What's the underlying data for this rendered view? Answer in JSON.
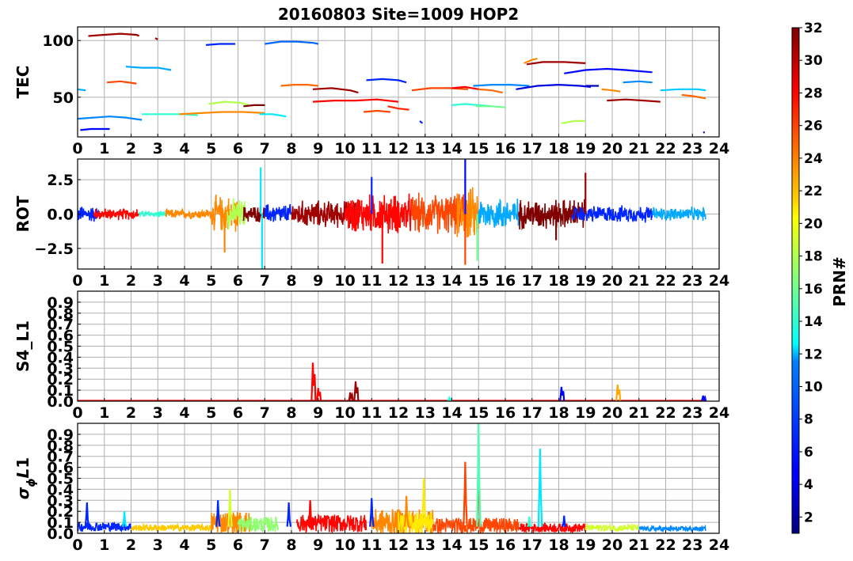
{
  "chart_data": [
    {
      "type": "line",
      "panel": "TEC",
      "title": "20160803 Site=1009 HOP2",
      "xlabel": "",
      "ylabel": "TEC",
      "xlim": [
        0,
        24
      ],
      "ylim": [
        15,
        112
      ],
      "x_ticks": [
        0,
        1,
        2,
        3,
        4,
        5,
        6,
        7,
        8,
        9,
        10,
        11,
        12,
        13,
        14,
        15,
        16,
        17,
        18,
        19,
        20,
        21,
        22,
        23,
        24
      ],
      "x_tick_labels": [
        "0",
        "1",
        "2",
        "3",
        "4",
        "5",
        "6",
        "7",
        "8",
        "9",
        "10",
        "11",
        "12",
        "13",
        "14",
        "15",
        "16",
        "17",
        "18",
        "19",
        "20",
        "21",
        "22",
        "23",
        "24"
      ],
      "y_ticks": [
        50,
        100
      ],
      "y_tick_labels": [
        "50",
        "100"
      ],
      "grid": true,
      "series": [
        {
          "prn": 31,
          "x": [
            0.4,
            1.0,
            1.6,
            2.2,
            2.3
          ],
          "y": [
            104,
            105,
            106,
            105,
            104
          ]
        },
        {
          "prn": 31,
          "x": [
            2.9,
            3.0
          ],
          "y": [
            102,
            101
          ]
        },
        {
          "prn": 6,
          "x": [
            4.8,
            5.3,
            5.9
          ],
          "y": [
            96,
            97,
            97
          ]
        },
        {
          "prn": 8,
          "x": [
            7.0,
            7.6,
            8.2,
            8.8,
            9.0
          ],
          "y": [
            97,
            99,
            99,
            98,
            97
          ]
        },
        {
          "prn": 10,
          "x": [
            1.8,
            2.4,
            3.0,
            3.5
          ],
          "y": [
            77,
            76,
            76,
            74
          ]
        },
        {
          "prn": 26,
          "x": [
            1.1,
            1.6,
            2.2
          ],
          "y": [
            63,
            64,
            62
          ]
        },
        {
          "prn": 10,
          "x": [
            0.0,
            0.3
          ],
          "y": [
            57,
            56
          ]
        },
        {
          "prn": 25,
          "x": [
            7.6,
            8.1,
            8.6,
            9.0
          ],
          "y": [
            60,
            61,
            61,
            60
          ]
        },
        {
          "prn": 31,
          "x": [
            8.8,
            9.5,
            10.2,
            10.5
          ],
          "y": [
            57,
            58,
            56,
            54
          ]
        },
        {
          "prn": 6,
          "x": [
            10.8,
            11.4,
            12.0,
            12.3
          ],
          "y": [
            65,
            66,
            65,
            63
          ]
        },
        {
          "prn": 26,
          "x": [
            12.5,
            13.2,
            13.9,
            14.6
          ],
          "y": [
            56,
            58,
            58,
            57
          ]
        },
        {
          "prn": 28,
          "x": [
            14.0,
            14.5,
            15.0
          ],
          "y": [
            58,
            59,
            57
          ]
        },
        {
          "prn": 9,
          "x": [
            14.8,
            15.5,
            16.2,
            16.9
          ],
          "y": [
            60,
            61,
            61,
            60
          ]
        },
        {
          "prn": 25,
          "x": [
            15.0,
            15.5,
            15.9
          ],
          "y": [
            57,
            56,
            54
          ]
        },
        {
          "prn": 4,
          "x": [
            16.4,
            17.2,
            18.0,
            18.8,
            19.2
          ],
          "y": [
            57,
            60,
            61,
            60,
            59
          ]
        },
        {
          "prn": 24,
          "x": [
            16.7,
            17.0,
            17.2
          ],
          "y": [
            80,
            83,
            84
          ]
        },
        {
          "prn": 31,
          "x": [
            16.8,
            17.4,
            18.2,
            19.0
          ],
          "y": [
            79,
            81,
            81,
            80
          ]
        },
        {
          "prn": 5,
          "x": [
            18.2,
            19.0,
            19.8,
            20.5,
            21.5
          ],
          "y": [
            71,
            74,
            75,
            74,
            72
          ]
        },
        {
          "prn": 9,
          "x": [
            20.4,
            21.0,
            21.5
          ],
          "y": [
            63,
            64,
            63
          ]
        },
        {
          "prn": 3,
          "x": [
            19.0,
            19.5
          ],
          "y": [
            60,
            60
          ]
        },
        {
          "prn": 24,
          "x": [
            19.6,
            20.0,
            20.3
          ],
          "y": [
            57,
            56,
            55
          ]
        },
        {
          "prn": 11,
          "x": [
            21.8,
            22.5,
            23.2,
            23.5
          ],
          "y": [
            56,
            57,
            57,
            56
          ]
        },
        {
          "prn": 25,
          "x": [
            22.6,
            23.0,
            23.5
          ],
          "y": [
            52,
            51,
            49
          ]
        },
        {
          "prn": 31,
          "x": [
            19.8,
            20.5,
            21.2,
            21.8
          ],
          "y": [
            47,
            48,
            47,
            46
          ]
        },
        {
          "prn": 28,
          "x": [
            8.8,
            9.6,
            10.4,
            11.2,
            12.0
          ],
          "y": [
            46,
            47,
            47,
            48,
            46
          ]
        },
        {
          "prn": 26,
          "x": [
            10.7,
            11.2,
            11.7
          ],
          "y": [
            37,
            38,
            37
          ]
        },
        {
          "prn": 27,
          "x": [
            11.6,
            12.0,
            12.4
          ],
          "y": [
            42,
            40,
            39
          ]
        },
        {
          "prn": 14,
          "x": [
            14.0,
            14.5,
            15.0,
            15.5
          ],
          "y": [
            43,
            44,
            43,
            42
          ]
        },
        {
          "prn": 16,
          "x": [
            14.9,
            15.5,
            16.0
          ],
          "y": [
            42,
            42,
            41
          ]
        },
        {
          "prn": 18,
          "x": [
            18.1,
            18.6,
            19.0
          ],
          "y": [
            27,
            29,
            29
          ]
        },
        {
          "prn": 6,
          "x": [
            12.8,
            12.9
          ],
          "y": [
            29,
            27
          ]
        },
        {
          "prn": 3,
          "x": [
            23.4
          ],
          "y": [
            19
          ]
        },
        {
          "prn": 9,
          "x": [
            0.0,
            0.6,
            1.2,
            1.8,
            2.4
          ],
          "y": [
            31,
            32,
            33,
            32,
            30
          ]
        },
        {
          "prn": 5,
          "x": [
            0.1,
            0.5,
            1.2
          ],
          "y": [
            21,
            22,
            22
          ]
        },
        {
          "prn": 14,
          "x": [
            2.4,
            3.2,
            4.0,
            4.5
          ],
          "y": [
            35,
            35,
            35,
            34
          ]
        },
        {
          "prn": 24,
          "x": [
            3.8,
            4.6,
            5.4,
            6.2,
            7.0
          ],
          "y": [
            35,
            36,
            37,
            37,
            36
          ]
        },
        {
          "prn": 18,
          "x": [
            4.9,
            5.5,
            6.1,
            6.4
          ],
          "y": [
            44,
            46,
            45,
            43
          ]
        },
        {
          "prn": 32,
          "x": [
            6.2,
            6.6,
            7.0
          ],
          "y": [
            42,
            43,
            43
          ]
        },
        {
          "prn": 12,
          "x": [
            6.8,
            7.3,
            7.8
          ],
          "y": [
            35,
            35,
            33
          ]
        }
      ]
    },
    {
      "type": "line",
      "panel": "ROT",
      "xlabel": "",
      "ylabel": "ROT",
      "xlim": [
        0,
        24
      ],
      "ylim": [
        -4,
        4
      ],
      "x_ticks": [
        0,
        1,
        2,
        3,
        4,
        5,
        6,
        7,
        8,
        9,
        10,
        11,
        12,
        13,
        14,
        15,
        16,
        17,
        18,
        19,
        20,
        21,
        22,
        23,
        24
      ],
      "x_tick_labels": [
        "0",
        "1",
        "2",
        "3",
        "4",
        "5",
        "6",
        "7",
        "8",
        "9",
        "10",
        "11",
        "12",
        "13",
        "14",
        "15",
        "16",
        "17",
        "18",
        "19",
        "20",
        "21",
        "22",
        "23",
        "24"
      ],
      "y_ticks": [
        -2.5,
        0.0,
        2.5
      ],
      "y_tick_labels": [
        "−2.5",
        "0.0",
        "2.5"
      ],
      "grid": true,
      "segments": [
        {
          "prn": 6,
          "start": 0.0,
          "end": 0.8,
          "amp": 0.5
        },
        {
          "prn": 28,
          "start": 0.6,
          "end": 2.3,
          "amp": 0.35
        },
        {
          "prn": 14,
          "start": 2.3,
          "end": 3.3,
          "amp": 0.2
        },
        {
          "prn": 24,
          "start": 3.3,
          "end": 5.0,
          "amp": 0.3
        },
        {
          "prn": 24,
          "start": 5.0,
          "end": 6.0,
          "amp": 1.1
        },
        {
          "prn": 18,
          "start": 5.6,
          "end": 6.3,
          "amp": 0.9
        },
        {
          "prn": 32,
          "start": 6.2,
          "end": 7.0,
          "amp": 0.5
        },
        {
          "prn": 6,
          "start": 7.0,
          "end": 8.0,
          "amp": 0.6
        },
        {
          "prn": 31,
          "start": 8.0,
          "end": 10.5,
          "amp": 0.8
        },
        {
          "prn": 28,
          "start": 10.0,
          "end": 12.5,
          "amp": 1.2
        },
        {
          "prn": 26,
          "start": 12.5,
          "end": 14.5,
          "amp": 1.2
        },
        {
          "prn": 24,
          "start": 14.2,
          "end": 15.0,
          "amp": 1.6
        },
        {
          "prn": 10,
          "start": 15.0,
          "end": 16.5,
          "amp": 1.0
        },
        {
          "prn": 32,
          "start": 16.5,
          "end": 19.0,
          "amp": 0.9
        },
        {
          "prn": 6,
          "start": 18.5,
          "end": 21.5,
          "amp": 0.5
        },
        {
          "prn": 10,
          "start": 21.5,
          "end": 23.5,
          "amp": 0.4
        }
      ],
      "spikes": [
        {
          "prn": 12,
          "x": 6.85,
          "y": 3.4
        },
        {
          "prn": 12,
          "x": 6.9,
          "y": -4.0
        },
        {
          "prn": 24,
          "x": 5.5,
          "y": -2.8
        },
        {
          "prn": 5,
          "x": 14.5,
          "y": 4.0
        },
        {
          "prn": 26,
          "x": 14.5,
          "y": -3.7
        },
        {
          "prn": 16,
          "x": 14.95,
          "y": -3.4
        },
        {
          "prn": 28,
          "x": 11.4,
          "y": -3.6
        },
        {
          "prn": 6,
          "x": 11.0,
          "y": 2.7
        },
        {
          "prn": 31,
          "x": 19.0,
          "y": 3.0
        },
        {
          "prn": 32,
          "x": 17.9,
          "y": -1.9
        }
      ]
    },
    {
      "type": "line",
      "panel": "S4_L1",
      "xlabel": "",
      "ylabel": "S4_L1",
      "xlim": [
        0,
        24
      ],
      "ylim": [
        0,
        1
      ],
      "x_ticks": [
        0,
        1,
        2,
        3,
        4,
        5,
        6,
        7,
        8,
        9,
        10,
        11,
        12,
        13,
        14,
        15,
        16,
        17,
        18,
        19,
        20,
        21,
        22,
        23,
        24
      ],
      "x_tick_labels": [
        "0",
        "1",
        "2",
        "3",
        "4",
        "5",
        "6",
        "7",
        "8",
        "9",
        "10",
        "11",
        "12",
        "13",
        "14",
        "15",
        "16",
        "17",
        "18",
        "19",
        "20",
        "21",
        "22",
        "23",
        "24"
      ],
      "y_ticks": [
        0.0,
        0.1,
        0.2,
        0.3,
        0.4,
        0.5,
        0.6,
        0.7,
        0.8,
        0.9
      ],
      "y_tick_labels": [
        "0.0",
        "0.1",
        "0.2",
        "0.3",
        "0.4",
        "0.5",
        "0.6",
        "0.7",
        "0.8",
        "0.9"
      ],
      "grid": true,
      "peaks": [
        {
          "prn": 28,
          "x": 8.8,
          "y": 0.35
        },
        {
          "prn": 28,
          "x": 9.0,
          "y": 0.12
        },
        {
          "prn": 31,
          "x": 10.4,
          "y": 0.18
        },
        {
          "prn": 31,
          "x": 10.2,
          "y": 0.08
        },
        {
          "prn": 5,
          "x": 18.1,
          "y": 0.13
        },
        {
          "prn": 23,
          "x": 20.2,
          "y": 0.15
        },
        {
          "prn": 5,
          "x": 23.4,
          "y": 0.05
        },
        {
          "prn": 14,
          "x": 13.9,
          "y": 0.03
        }
      ]
    },
    {
      "type": "line",
      "panel": "sigma_phi_L1",
      "xlabel": "",
      "ylabel": "σϕL1",
      "xlim": [
        0,
        24
      ],
      "ylim": [
        0,
        1
      ],
      "x_ticks": [
        0,
        1,
        2,
        3,
        4,
        5,
        6,
        7,
        8,
        9,
        10,
        11,
        12,
        13,
        14,
        15,
        16,
        17,
        18,
        19,
        20,
        21,
        22,
        23,
        24
      ],
      "x_tick_labels": [
        "0",
        "1",
        "2",
        "3",
        "4",
        "5",
        "6",
        "7",
        "8",
        "9",
        "10",
        "11",
        "12",
        "13",
        "14",
        "15",
        "16",
        "17",
        "18",
        "19",
        "20",
        "21",
        "22",
        "23",
        "24"
      ],
      "y_ticks": [
        0.0,
        0.1,
        0.2,
        0.3,
        0.4,
        0.5,
        0.6,
        0.7,
        0.8,
        0.9
      ],
      "y_tick_labels": [
        "0.0",
        "0.1",
        "0.2",
        "0.3",
        "0.4",
        "0.5",
        "0.6",
        "0.7",
        "0.8",
        "0.9"
      ],
      "grid": true,
      "segments": [
        {
          "prn": 6,
          "start": 0.0,
          "end": 2.0,
          "base": 0.06,
          "amp": 0.04
        },
        {
          "prn": 22,
          "start": 2.0,
          "end": 5.0,
          "base": 0.05,
          "amp": 0.03
        },
        {
          "prn": 24,
          "start": 5.0,
          "end": 6.5,
          "base": 0.1,
          "amp": 0.1
        },
        {
          "prn": 17,
          "start": 6.0,
          "end": 7.5,
          "base": 0.08,
          "amp": 0.07
        },
        {
          "prn": 28,
          "start": 8.2,
          "end": 10.8,
          "base": 0.09,
          "amp": 0.08
        },
        {
          "prn": 24,
          "start": 11.0,
          "end": 13.3,
          "base": 0.1,
          "amp": 0.12
        },
        {
          "prn": 21,
          "start": 12.0,
          "end": 13.3,
          "base": 0.1,
          "amp": 0.1
        },
        {
          "prn": 26,
          "start": 13.3,
          "end": 16.5,
          "base": 0.07,
          "amp": 0.07
        },
        {
          "prn": 28,
          "start": 16.5,
          "end": 19.0,
          "base": 0.05,
          "amp": 0.04
        },
        {
          "prn": 19,
          "start": 19.0,
          "end": 21.0,
          "base": 0.05,
          "amp": 0.03
        },
        {
          "prn": 9,
          "start": 21.0,
          "end": 23.5,
          "base": 0.04,
          "amp": 0.02
        }
      ],
      "peaks": [
        {
          "prn": 6,
          "x": 0.35,
          "y": 0.28
        },
        {
          "prn": 12,
          "x": 1.75,
          "y": 0.2
        },
        {
          "prn": 6,
          "x": 5.25,
          "y": 0.3
        },
        {
          "prn": 19,
          "x": 5.7,
          "y": 0.4
        },
        {
          "prn": 6,
          "x": 7.9,
          "y": 0.28
        },
        {
          "prn": 28,
          "x": 8.7,
          "y": 0.3
        },
        {
          "prn": 6,
          "x": 11.0,
          "y": 0.32
        },
        {
          "prn": 21,
          "x": 12.95,
          "y": 0.5
        },
        {
          "prn": 24,
          "x": 12.3,
          "y": 0.34
        },
        {
          "prn": 26,
          "x": 14.5,
          "y": 0.65
        },
        {
          "prn": 26,
          "x": 15.0,
          "y": 0.68
        },
        {
          "prn": 15,
          "x": 15.0,
          "y": 1.0
        },
        {
          "prn": 12,
          "x": 17.3,
          "y": 0.77
        },
        {
          "prn": 6,
          "x": 18.2,
          "y": 0.16
        },
        {
          "prn": 14,
          "x": 16.9,
          "y": 0.15
        }
      ]
    }
  ],
  "colorbar": {
    "label": "PRN#",
    "min": 1,
    "max": 32,
    "ticks": [
      2,
      4,
      6,
      8,
      10,
      12,
      14,
      16,
      18,
      20,
      22,
      24,
      26,
      28,
      30,
      32
    ],
    "tick_labels": [
      "2",
      "4",
      "6",
      "8",
      "10",
      "12",
      "14",
      "16",
      "18",
      "20",
      "22",
      "24",
      "26",
      "28",
      "30",
      "32"
    ],
    "colormap": "jet"
  }
}
